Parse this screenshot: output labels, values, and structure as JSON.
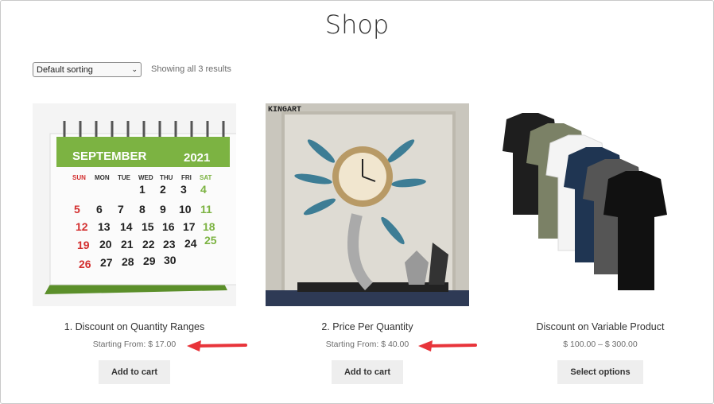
{
  "page": {
    "title": "Shop"
  },
  "toolbar": {
    "sorting_selected": "Default sorting",
    "result_count": "Showing all 3 results"
  },
  "products": [
    {
      "title": "1. Discount on Quantity Ranges",
      "price": "Starting From: $ 17.00",
      "button": "Add to cart",
      "image": {
        "month": "SEPTEMBER",
        "year": "2021",
        "days": [
          "SUN",
          "MON",
          "TUE",
          "WED",
          "THU",
          "FRI",
          "SAT"
        ]
      }
    },
    {
      "title": "2. Price Per Quantity",
      "price": "Starting From: $ 40.00",
      "button": "Add to cart",
      "image": {
        "watermark": "KINGART"
      }
    },
    {
      "title": "Discount on Variable Product",
      "price": "$ 100.00 – $ 300.00",
      "button": "Select options"
    }
  ],
  "colors": {
    "arrow": "#e8343a",
    "calendar_green": "#7cb342",
    "button_bg": "#eeeeee"
  },
  "icons": {
    "sort": "chevron-down-icon",
    "annotation": "arrow-left-icon"
  }
}
